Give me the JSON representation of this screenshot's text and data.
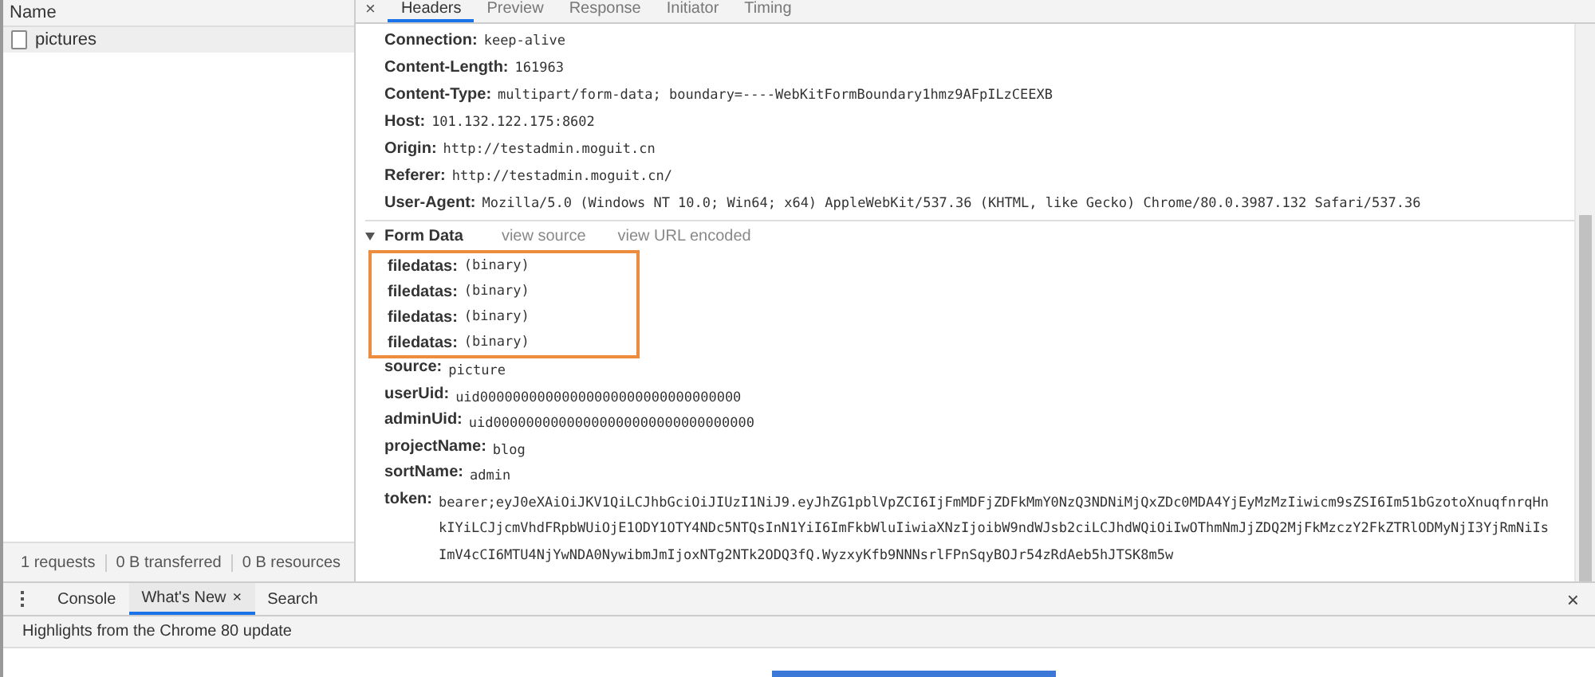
{
  "requests_panel": {
    "column_header": "Name",
    "rows": [
      {
        "name": "pictures",
        "selected": true
      }
    ],
    "status_bar": [
      "1 requests",
      "0 B transferred",
      "0 B resources"
    ]
  },
  "detail_tabs": [
    {
      "label": "Headers",
      "selected": true
    },
    {
      "label": "Preview",
      "selected": false
    },
    {
      "label": "Response",
      "selected": false
    },
    {
      "label": "Initiator",
      "selected": false
    },
    {
      "label": "Timing",
      "selected": false
    }
  ],
  "request_headers": [
    {
      "name": "Connection:",
      "value": "keep-alive"
    },
    {
      "name": "Content-Length:",
      "value": "161963"
    },
    {
      "name": "Content-Type:",
      "value": "multipart/form-data; boundary=----WebKitFormBoundary1hmz9AFpILzCEEXB"
    },
    {
      "name": "Host:",
      "value": "101.132.122.175:8602"
    },
    {
      "name": "Origin:",
      "value": "http://testadmin.moguit.cn"
    },
    {
      "name": "Referer:",
      "value": "http://testadmin.moguit.cn/"
    },
    {
      "name": "User-Agent:",
      "value": "Mozilla/5.0 (Windows NT 10.0; Win64; x64) AppleWebKit/537.36 (KHTML, like Gecko) Chrome/80.0.3987.132 Safari/537.36"
    }
  ],
  "form_data": {
    "title": "Form Data",
    "expanded": true,
    "links": [
      "view source",
      "view URL encoded"
    ],
    "fields": [
      {
        "name": "filedatas:",
        "value": "(binary)",
        "highlighted": true
      },
      {
        "name": "filedatas:",
        "value": "(binary)",
        "highlighted": true
      },
      {
        "name": "filedatas:",
        "value": "(binary)",
        "highlighted": true
      },
      {
        "name": "filedatas:",
        "value": "(binary)",
        "highlighted": true
      },
      {
        "name": "source:",
        "value": "picture",
        "highlighted": false
      },
      {
        "name": "userUid:",
        "value": "uid00000000000000000000000000000000",
        "highlighted": false
      },
      {
        "name": "adminUid:",
        "value": "uid00000000000000000000000000000000",
        "highlighted": false
      },
      {
        "name": "projectName:",
        "value": "blog",
        "highlighted": false
      },
      {
        "name": "sortName:",
        "value": "admin",
        "highlighted": false
      },
      {
        "name": "token:",
        "value": "bearer;eyJ0eXAiOiJKV1QiLCJhbGciOiJIUzI1NiJ9.eyJhZG1pblVpZCI6IjFmMDFjZDFkMmY0NzQ3NDNiMjQxZDc0MDA4YjEyMzMzIiwicm9sZSI6Im51bGzotoXnuqfnrqHnkIYiLCJjcmVhdFRpbWUiOjE1ODY1OTY4NDc5NTQsInN1YiI6ImFkbWluIiwiaXNzIjoibW9ndWJsb2ciLCJhdWQiOiIwOThmNmJjZDQ2MjFkMzczY2FkZTRlODMyNjI3YjRmNiIsImV4cCI6MTU4NjYwNDA0NywibmJmIjoxNTg2NTk2ODQ3fQ.WyzxyKfb9NNNsrlFPnSqyBOJr54zRdAeb5hJTSK8m5w",
        "highlighted": false
      }
    ]
  },
  "drawer": {
    "tabs": [
      {
        "label": "Console",
        "selected": false,
        "closable": false
      },
      {
        "label": "What's New",
        "selected": true,
        "closable": true
      },
      {
        "label": "Search",
        "selected": false,
        "closable": false
      }
    ],
    "close_glyph": "×",
    "tab_close_glyph": "×",
    "headline": "Highlights from the Chrome 80 update"
  }
}
